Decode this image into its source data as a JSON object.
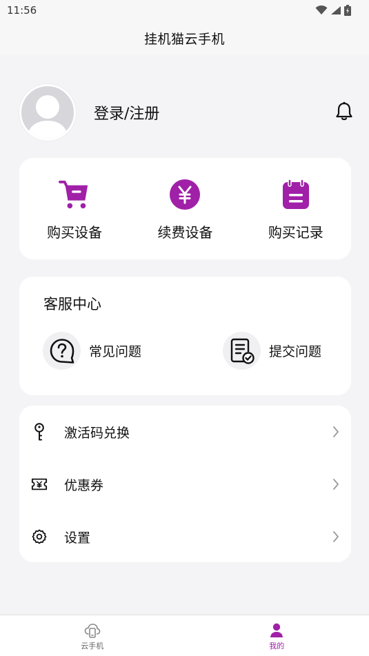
{
  "status": {
    "time": "11:56"
  },
  "header": {
    "title": "挂机猫云手机"
  },
  "profile": {
    "login_label": "登录/注册"
  },
  "actions": [
    {
      "label": "购买设备",
      "icon": "cart-icon"
    },
    {
      "label": "续费设备",
      "icon": "yen-coin-icon"
    },
    {
      "label": "购买记录",
      "icon": "calendar-icon"
    }
  ],
  "support": {
    "title": "客服中心",
    "items": [
      {
        "label": "常见问题",
        "icon": "question-bubble-icon"
      },
      {
        "label": "提交问题",
        "icon": "document-check-icon"
      }
    ]
  },
  "menu": [
    {
      "label": "激活码兑换",
      "icon": "key-icon"
    },
    {
      "label": "优惠券",
      "icon": "coupon-icon"
    },
    {
      "label": "设置",
      "icon": "gear-icon"
    }
  ],
  "tabs": [
    {
      "label": "云手机",
      "icon": "cloud-phone-icon",
      "active": false
    },
    {
      "label": "我的",
      "icon": "person-icon",
      "active": true
    }
  ],
  "colors": {
    "accent": "#a020a8",
    "background": "#f4f4f6",
    "card": "#ffffff"
  }
}
